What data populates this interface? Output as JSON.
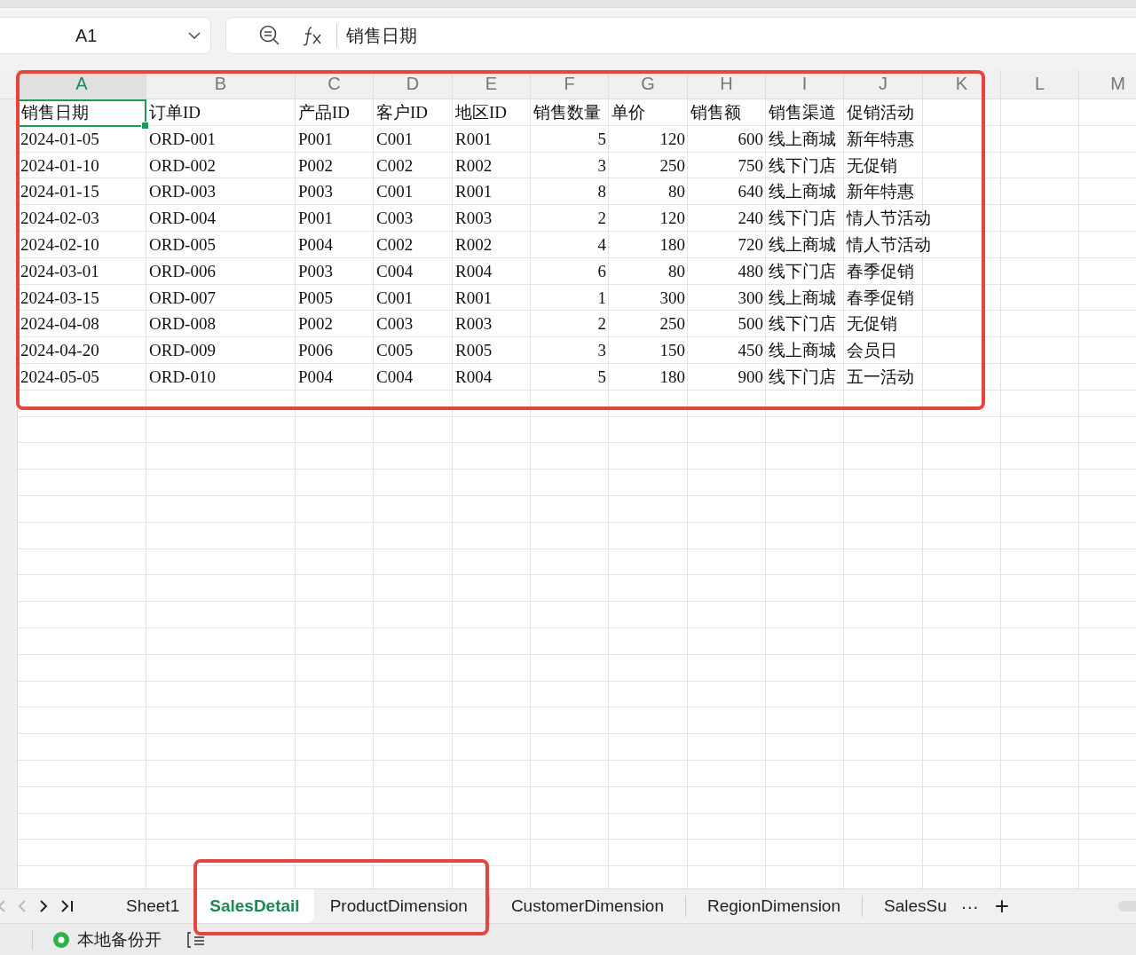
{
  "name_box": {
    "value": "A1"
  },
  "formula_bar": {
    "value": "销售日期"
  },
  "columns": [
    {
      "label": "A",
      "selected": true,
      "kind": "text"
    },
    {
      "label": "B",
      "selected": false,
      "kind": "text"
    },
    {
      "label": "C",
      "selected": false,
      "kind": "text"
    },
    {
      "label": "D",
      "selected": false,
      "kind": "text"
    },
    {
      "label": "E",
      "selected": false,
      "kind": "text"
    },
    {
      "label": "F",
      "selected": false,
      "kind": "number"
    },
    {
      "label": "G",
      "selected": false,
      "kind": "number"
    },
    {
      "label": "H",
      "selected": false,
      "kind": "number"
    },
    {
      "label": "I",
      "selected": false,
      "kind": "text"
    },
    {
      "label": "J",
      "selected": false,
      "kind": "text"
    },
    {
      "label": "K",
      "selected": false,
      "kind": "text"
    },
    {
      "label": "L",
      "selected": false,
      "kind": "text"
    },
    {
      "label": "M",
      "selected": false,
      "kind": "text"
    }
  ],
  "rows": [
    {
      "selected": true,
      "kind": "header",
      "cells": [
        "销售日期",
        "订单ID",
        "产品ID",
        "客户ID",
        "地区ID",
        "销售数量",
        "单价",
        "销售额",
        "销售渠道",
        "促销活动"
      ]
    },
    {
      "selected": false,
      "kind": "data",
      "cells": [
        "2024-01-05",
        "ORD-001",
        "P001",
        "C001",
        "R001",
        "5",
        "120",
        "600",
        "线上商城",
        "新年特惠"
      ]
    },
    {
      "selected": false,
      "kind": "data",
      "cells": [
        "2024-01-10",
        "ORD-002",
        "P002",
        "C002",
        "R002",
        "3",
        "250",
        "750",
        "线下门店",
        "无促销"
      ]
    },
    {
      "selected": false,
      "kind": "data",
      "cells": [
        "2024-01-15",
        "ORD-003",
        "P003",
        "C001",
        "R001",
        "8",
        "80",
        "640",
        "线上商城",
        "新年特惠"
      ]
    },
    {
      "selected": false,
      "kind": "data",
      "cells": [
        "2024-02-03",
        "ORD-004",
        "P001",
        "C003",
        "R003",
        "2",
        "120",
        "240",
        "线下门店",
        "情人节活动"
      ]
    },
    {
      "selected": false,
      "kind": "data",
      "cells": [
        "2024-02-10",
        "ORD-005",
        "P004",
        "C002",
        "R002",
        "4",
        "180",
        "720",
        "线上商城",
        "情人节活动"
      ]
    },
    {
      "selected": false,
      "kind": "data",
      "cells": [
        "2024-03-01",
        "ORD-006",
        "P003",
        "C004",
        "R004",
        "6",
        "80",
        "480",
        "线下门店",
        "春季促销"
      ]
    },
    {
      "selected": false,
      "kind": "data",
      "cells": [
        "2024-03-15",
        "ORD-007",
        "P005",
        "C001",
        "R001",
        "1",
        "300",
        "300",
        "线上商城",
        "春季促销"
      ]
    },
    {
      "selected": false,
      "kind": "data",
      "cells": [
        "2024-04-08",
        "ORD-008",
        "P002",
        "C003",
        "R003",
        "2",
        "250",
        "500",
        "线下门店",
        "无促销"
      ]
    },
    {
      "selected": false,
      "kind": "data",
      "cells": [
        "2024-04-20",
        "ORD-009",
        "P006",
        "C005",
        "R005",
        "3",
        "150",
        "450",
        "线上商城",
        "会员日"
      ]
    },
    {
      "selected": false,
      "kind": "data",
      "cells": [
        "2024-05-05",
        "ORD-010",
        "P004",
        "C004",
        "R004",
        "5",
        "180",
        "900",
        "线下门店",
        "五一活动"
      ]
    }
  ],
  "sheet_tabs": [
    {
      "label": "Sheet1",
      "selected": false
    },
    {
      "label": "SalesDetail",
      "selected": true
    },
    {
      "label": "ProductDimension",
      "selected": false
    },
    {
      "label": "CustomerDimension",
      "selected": false
    },
    {
      "label": "RegionDimension",
      "selected": false
    },
    {
      "label": "SalesSu",
      "selected": false
    }
  ],
  "tab_controls": {
    "more": "···",
    "add": "+"
  },
  "status_bar": {
    "backup": {
      "label": "本地备份开",
      "on": true
    }
  }
}
